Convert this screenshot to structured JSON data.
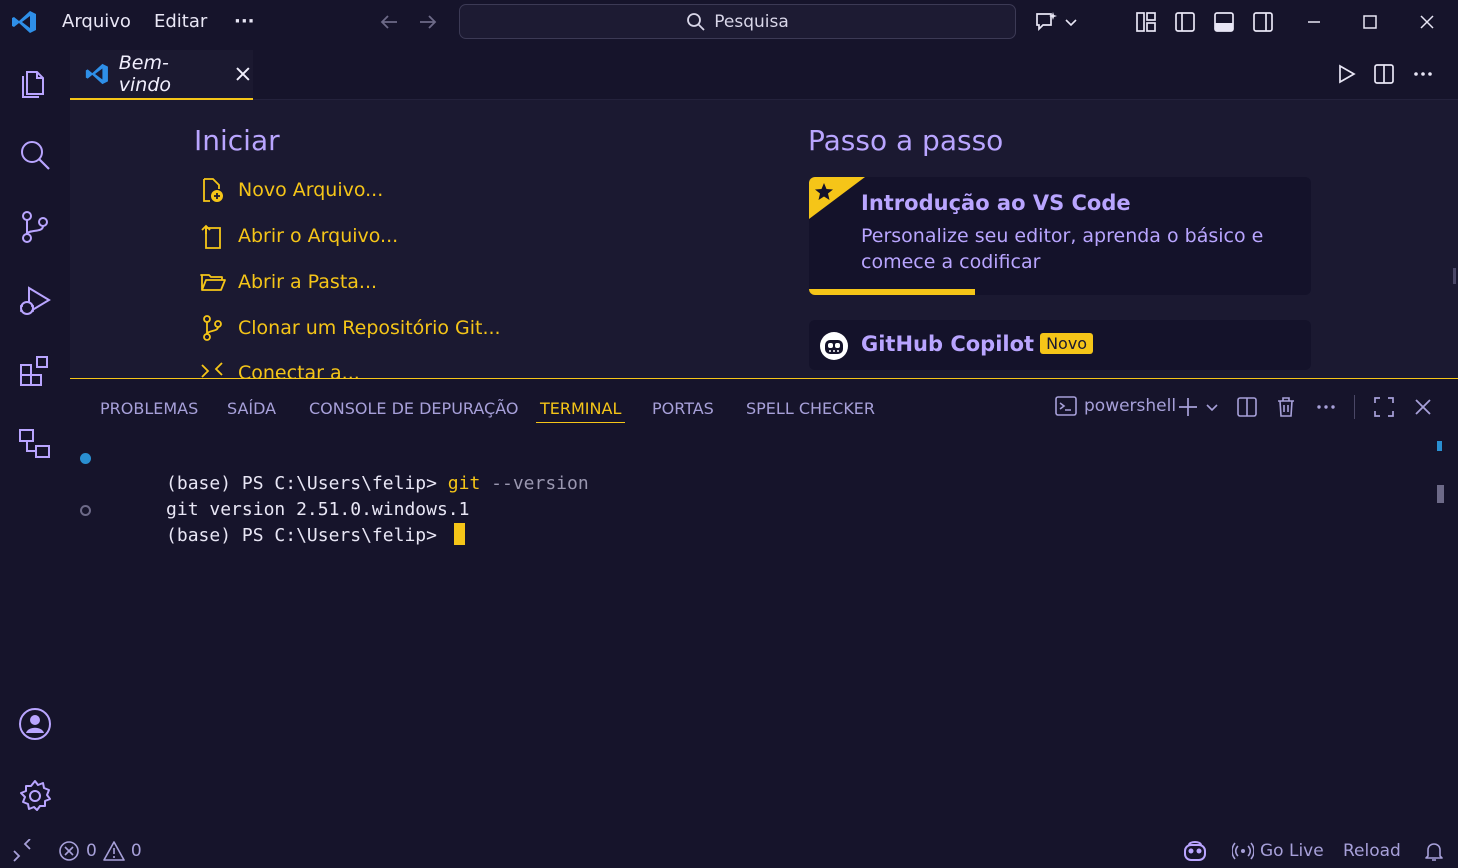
{
  "titlebar": {
    "menu": [
      "Arquivo",
      "Editar"
    ],
    "more": "···",
    "search_placeholder": "Pesquisa"
  },
  "editor": {
    "tab_label": "Bem-vindo",
    "start": {
      "title": "Iniciar",
      "items": [
        {
          "label": "Novo Arquivo...",
          "icon": "new-file-icon"
        },
        {
          "label": "Abrir o Arquivo...",
          "icon": "open-file-icon"
        },
        {
          "label": "Abrir a Pasta...",
          "icon": "folder-icon"
        },
        {
          "label": "Clonar um Repositório Git...",
          "icon": "git-branch-icon"
        },
        {
          "label": "Conectar a...",
          "icon": "remote-icon"
        }
      ]
    },
    "walkthrough": {
      "title": "Passo a passo",
      "card1_title": "Introdução ao VS Code",
      "card1_desc": "Personalize seu editor, aprenda o básico e comece a codificar",
      "card1_progress": 0.33,
      "card2_title": "GitHub Copilot",
      "card2_badge": "Novo"
    }
  },
  "panel": {
    "tabs": [
      "PROBLEMAS",
      "SAÍDA",
      "CONSOLE DE DEPURAÇÃO",
      "TERMINAL",
      "PORTAS",
      "SPELL CHECKER"
    ],
    "active_tab": "TERMINAL",
    "shell": "powershell",
    "terminal": {
      "line1_prompt": "(base) PS C:\\Users\\felip> ",
      "line1_cmd": "git",
      "line1_args": " --version",
      "line2": "git version 2.51.0.windows.1",
      "line3_prompt": "(base) PS C:\\Users\\felip> "
    }
  },
  "statusbar": {
    "errors": "0",
    "warnings": "0",
    "go_live": "Go Live",
    "reload": "Reload"
  },
  "colors": {
    "accent": "#f5c518",
    "purple": "#b9a5ff",
    "background": "#16142b"
  }
}
